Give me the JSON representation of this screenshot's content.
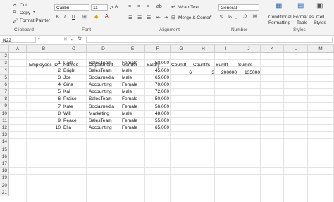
{
  "ribbon": {
    "clipboard": {
      "cut": "Cut",
      "copy": "Copy",
      "format_painter": "Format Painter",
      "label": "Clipboard"
    },
    "font": {
      "name": "Calibri",
      "size": "11",
      "label": "Font",
      "bold": "B",
      "italic": "I",
      "underline": "U",
      "grow": "A",
      "shrink": "A"
    },
    "alignment": {
      "wrap_text": "Wrap Text",
      "merge_center": "Merge & Center",
      "label": "Alignment"
    },
    "number": {
      "format": "General",
      "currency": "$",
      "percent": "%",
      "comma": ",",
      "label": "Number"
    },
    "styles": {
      "conditional": "Conditional",
      "conditional2": "Formatting",
      "format_as": "Format as",
      "table": "Table",
      "cell": "Cell",
      "styles2": "Styles",
      "label": "Styles"
    }
  },
  "formula_bar": {
    "name_box": "N22",
    "fx": "fx",
    "formula": ""
  },
  "columns": [
    "A",
    "B",
    "C",
    "D",
    "E",
    "F",
    "G",
    "H",
    "I",
    "J",
    "K",
    "L",
    "M"
  ],
  "rows": [
    "2",
    "3",
    "4",
    "5",
    "6",
    "7",
    "8",
    "9",
    "10",
    "11",
    "12",
    "13",
    "14",
    "15",
    "16",
    "17",
    "18",
    "19",
    "20",
    "21"
  ],
  "headers": {
    "b": "Employees ID",
    "c": "Names",
    "d": "Department",
    "e": "Gender",
    "f": "Salary",
    "g": "CountIf",
    "h": "Countifs",
    "i": "SumIf",
    "j": "Sumifs"
  },
  "results": {
    "countif": "6",
    "countifs": "3",
    "sumif": "200000",
    "sumifs": "135000"
  },
  "employees": [
    {
      "id": "1",
      "name": "Pam",
      "dept": "SalesTeam",
      "gender": "Female",
      "salary": "50,000"
    },
    {
      "id": "2",
      "name": "Bright",
      "dept": "SalesTeam",
      "gender": "Male",
      "salary": "45,000"
    },
    {
      "id": "3",
      "name": "Joe",
      "dept": "Socialmedia",
      "gender": "Male",
      "salary": "65,000"
    },
    {
      "id": "4",
      "name": "Gina",
      "dept": "Accounting",
      "gender": "Female",
      "salary": "70,000"
    },
    {
      "id": "5",
      "name": "Kal",
      "dept": "Accounting",
      "gender": "Male",
      "salary": "72,000"
    },
    {
      "id": "6",
      "name": "Praise",
      "dept": "SalesTeam",
      "gender": "Female",
      "salary": "50,000"
    },
    {
      "id": "7",
      "name": "Kate",
      "dept": "Socialmedia",
      "gender": "Female",
      "salary": "56,000"
    },
    {
      "id": "8",
      "name": "Will",
      "dept": "Marketing",
      "gender": "Male",
      "salary": "48,000"
    },
    {
      "id": "9",
      "name": "Peace",
      "dept": "SalesTeam",
      "gender": "Female",
      "salary": "55,000"
    },
    {
      "id": "10",
      "name": "Ella",
      "dept": "Accounting",
      "gender": "Female",
      "salary": "65,000"
    }
  ]
}
